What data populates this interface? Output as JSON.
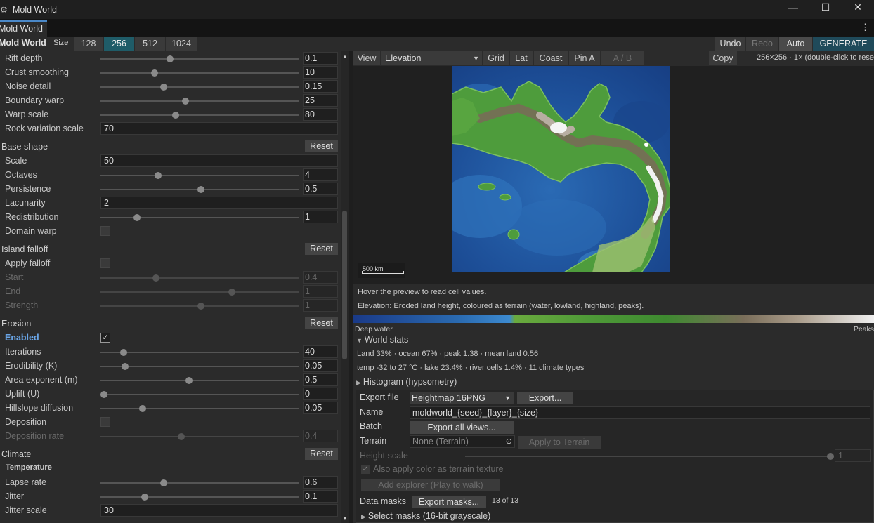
{
  "window": {
    "title": "Mold World",
    "minimize": "—",
    "maximize": "☐",
    "close": "✕"
  },
  "tab": {
    "label": "Mold World",
    "menu": "⋮"
  },
  "toolbar": {
    "title": "Mold World",
    "size_label": "Size",
    "sizes": [
      "128",
      "256",
      "512",
      "1024"
    ],
    "active_size": "256",
    "undo": "Undo",
    "redo": "Redo",
    "auto": "Auto",
    "generate": "GENERATE"
  },
  "params": [
    {
      "type": "slider",
      "label": "Rift depth",
      "value": "0.1",
      "pos": 0.34
    },
    {
      "type": "slider",
      "label": "Crust smoothing",
      "value": "10",
      "pos": 0.26
    },
    {
      "type": "slider",
      "label": "Noise detail",
      "value": "0.15",
      "pos": 0.31
    },
    {
      "type": "slider",
      "label": "Boundary warp",
      "value": "25",
      "pos": 0.42
    },
    {
      "type": "slider",
      "label": "Warp scale",
      "value": "80",
      "pos": 0.37
    },
    {
      "type": "input",
      "label": "Rock variation scale",
      "value": "70"
    },
    {
      "type": "section",
      "label": "Base shape",
      "reset": "Reset"
    },
    {
      "type": "input",
      "label": "Scale",
      "value": "50"
    },
    {
      "type": "slider",
      "label": "Octaves",
      "value": "4",
      "pos": 0.28
    },
    {
      "type": "slider",
      "label": "Persistence",
      "value": "0.5",
      "pos": 0.5
    },
    {
      "type": "input",
      "label": "Lacunarity",
      "value": "2"
    },
    {
      "type": "slider",
      "label": "Redistribution",
      "value": "1",
      "pos": 0.17
    },
    {
      "type": "check",
      "label": "Domain warp",
      "checked": false
    },
    {
      "type": "section",
      "label": "Island falloff",
      "reset": "Reset"
    },
    {
      "type": "check",
      "label": "Apply falloff",
      "checked": false
    },
    {
      "type": "slider",
      "label": "Start",
      "value": "0.4",
      "pos": 0.27,
      "disabled": true
    },
    {
      "type": "slider",
      "label": "End",
      "value": "1",
      "pos": 0.66,
      "disabled": true
    },
    {
      "type": "slider",
      "label": "Strength",
      "value": "1",
      "pos": 0.5,
      "disabled": true
    },
    {
      "type": "section",
      "label": "Erosion",
      "reset": "Reset"
    },
    {
      "type": "check",
      "label": "Enabled",
      "checked": true,
      "highlight": true
    },
    {
      "type": "slider",
      "label": "Iterations",
      "value": "40",
      "pos": 0.1
    },
    {
      "type": "slider",
      "label": "Erodibility (K)",
      "value": "0.05",
      "pos": 0.11
    },
    {
      "type": "slider",
      "label": "Area exponent (m)",
      "value": "0.5",
      "pos": 0.44
    },
    {
      "type": "slider",
      "label": "Uplift (U)",
      "value": "0",
      "pos": 0.0
    },
    {
      "type": "slider",
      "label": "Hillslope diffusion",
      "value": "0.05",
      "pos": 0.2
    },
    {
      "type": "check",
      "label": "Deposition",
      "checked": false
    },
    {
      "type": "slider",
      "label": "Deposition rate",
      "value": "0.4",
      "pos": 0.4,
      "disabled": true
    },
    {
      "type": "section",
      "label": "Climate",
      "reset": "Reset"
    },
    {
      "type": "sub",
      "label": "Temperature"
    },
    {
      "type": "slider",
      "label": "Lapse rate",
      "value": "0.6",
      "pos": 0.31
    },
    {
      "type": "slider",
      "label": "Jitter",
      "value": "0.1",
      "pos": 0.21
    },
    {
      "type": "input",
      "label": "Jitter scale",
      "value": "30"
    }
  ],
  "view": {
    "label": "View",
    "layer": "Elevation",
    "buttons": [
      "Grid",
      "Lat",
      "Coast",
      "Pin A"
    ],
    "ab": "A / B",
    "copy": "Copy",
    "info": "256×256 · 1× (double-click to reset)"
  },
  "preview": {
    "scale_label": "500 km"
  },
  "hover_hint": "Hover the preview to read cell values.",
  "layer_desc": "Elevation: Eroded land height, coloured as terrain (water, lowland, highland, peaks).",
  "legend": {
    "left": "Deep water",
    "right": "Peaks"
  },
  "stats": {
    "title": "World stats",
    "line1": "Land 33%  ·  ocean 67%  ·  peak 1.38  ·  mean land 0.56",
    "line2": "temp -32 to 27 °C  ·  lake 23.4%  ·  river cells 1.4%  ·  11 climate types"
  },
  "histogram": {
    "title": "Histogram (hypsometry)"
  },
  "export": {
    "file_label": "Export file",
    "format": "Heightmap 16PNG",
    "export_btn": "Export...",
    "name_label": "Name",
    "name_value": "moldworld_{seed}_{layer}_{size}",
    "batch_label": "Batch",
    "batch_btn": "Export all views...",
    "terrain_label": "Terrain",
    "terrain_value": "None (Terrain)",
    "apply_btn": "Apply to Terrain",
    "height_label": "Height scale",
    "height_value": "1",
    "color_tex": "Also apply color as terrain texture",
    "explorer_btn": "Add explorer (Play to walk)",
    "masks_label": "Data masks",
    "masks_btn": "Export masks...",
    "masks_count": "13 of 13",
    "select_masks": "Select masks (16-bit grayscale)"
  }
}
